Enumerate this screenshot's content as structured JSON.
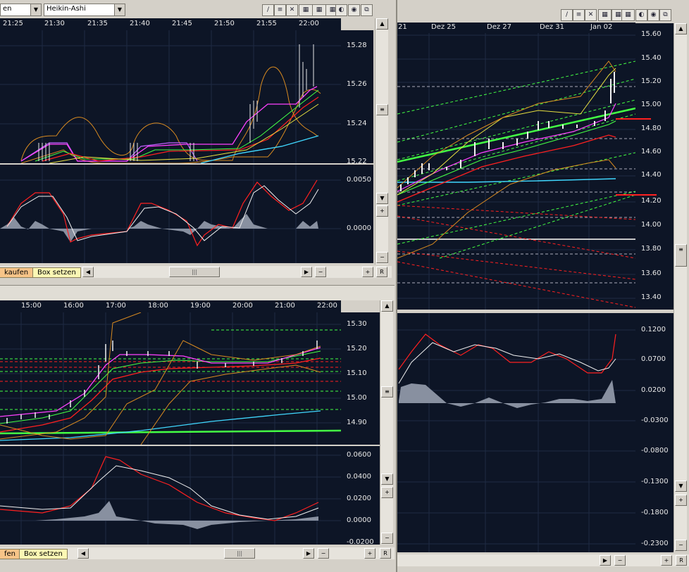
{
  "window1": {
    "combo1": "en",
    "combo2": "Heikin-Ashi",
    "time_ticks": [
      "21:25",
      "21:30",
      "21:35",
      "21:40",
      "21:45",
      "21:50",
      "21:55",
      "22:00"
    ],
    "price_ticks": [
      "15.28",
      "15.26",
      "15.24",
      "15.22"
    ],
    "osc_ticks": [
      "0.0050",
      "0.0000"
    ],
    "btn_sell": "kaufen",
    "btn_box": "Box setzen",
    "r_label": "R"
  },
  "window2": {
    "time_ticks": [
      "15:00",
      "16:00",
      "17:00",
      "18:00",
      "19:00",
      "20:00",
      "21:00",
      "22:00"
    ],
    "price_ticks": [
      "15.30",
      "15.20",
      "15.10",
      "15.00",
      "14.90"
    ],
    "osc_ticks": [
      "0.0600",
      "0.0400",
      "0.0200",
      "0.0000",
      "-0.0200"
    ],
    "btn_sell": "fen",
    "btn_box": "Box setzen",
    "r_label": "R"
  },
  "window3": {
    "time_ticks": [
      "21",
      "Dez 25",
      "Dez 27",
      "Dez 31",
      "Jan 02"
    ],
    "price_ticks": [
      "15.60",
      "15.40",
      "15.20",
      "15.00",
      "14.80",
      "14.60",
      "14.40",
      "14.20",
      "14.00",
      "13.80",
      "13.60",
      "13.40"
    ],
    "osc_ticks": [
      "0.1200",
      "0.0700",
      "0.0200",
      "-0.0300",
      "-0.0800",
      "-0.1300",
      "-0.1800",
      "-0.2300"
    ],
    "r_label": "R"
  },
  "icons": {
    "draw": "pencil-icon",
    "tools": "tools-icon",
    "grid": "grid-icon",
    "settings": "settings-icon",
    "float": "float-window-icon"
  },
  "colors": {
    "plot_bg": "#0d1526",
    "accent_green": "#44ff44",
    "red_line": "#ff2020",
    "cyan": "#40d8ff",
    "magenta": "#ff40ff",
    "orange": "#d88a20",
    "histogram": "#8890a0"
  }
}
